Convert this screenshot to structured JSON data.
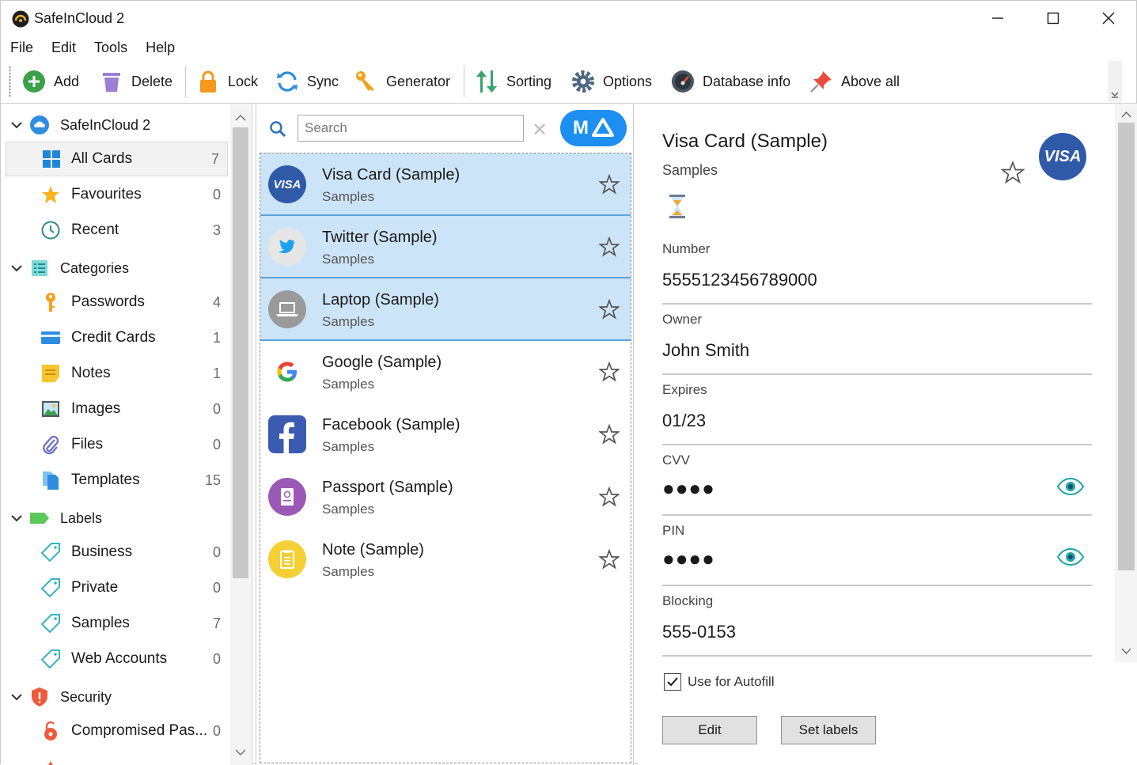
{
  "window": {
    "title": "SafeInCloud 2"
  },
  "menu": [
    "File",
    "Edit",
    "Tools",
    "Help"
  ],
  "toolbar": {
    "add": "Add",
    "delete": "Delete",
    "lock": "Lock",
    "sync": "Sync",
    "generator": "Generator",
    "sorting": "Sorting",
    "options": "Options",
    "database_info": "Database info",
    "above_all": "Above all"
  },
  "sidebar": {
    "root": "SafeInCloud 2",
    "all_cards": {
      "label": "All Cards",
      "count": "7"
    },
    "favourites": {
      "label": "Favourites",
      "count": "0"
    },
    "recent": {
      "label": "Recent",
      "count": "3"
    },
    "categories": {
      "label": "Categories",
      "items": [
        {
          "label": "Passwords",
          "count": "4"
        },
        {
          "label": "Credit Cards",
          "count": "1"
        },
        {
          "label": "Notes",
          "count": "1"
        },
        {
          "label": "Images",
          "count": "0"
        },
        {
          "label": "Files",
          "count": "0"
        },
        {
          "label": "Templates",
          "count": "15"
        }
      ]
    },
    "labels": {
      "label": "Labels",
      "items": [
        {
          "label": "Business",
          "count": "0"
        },
        {
          "label": "Private",
          "count": "0"
        },
        {
          "label": "Samples",
          "count": "7"
        },
        {
          "label": "Web Accounts",
          "count": "0"
        }
      ]
    },
    "security": {
      "label": "Security",
      "items": [
        {
          "label": "Compromised Pas...",
          "count": "0"
        }
      ]
    }
  },
  "search": {
    "placeholder": "Search",
    "badge": "M"
  },
  "cards": [
    {
      "title": "Visa Card (Sample)",
      "subtitle": "Samples",
      "selected": true,
      "icon": "visa-icon"
    },
    {
      "title": "Twitter (Sample)",
      "subtitle": "Samples",
      "selected": true,
      "icon": "twitter-icon"
    },
    {
      "title": "Laptop (Sample)",
      "subtitle": "Samples",
      "selected": true,
      "icon": "laptop-icon"
    },
    {
      "title": "Google (Sample)",
      "subtitle": "Samples",
      "selected": false,
      "icon": "google-icon"
    },
    {
      "title": "Facebook (Sample)",
      "subtitle": "Samples",
      "selected": false,
      "icon": "facebook-icon"
    },
    {
      "title": "Passport (Sample)",
      "subtitle": "Samples",
      "selected": false,
      "icon": "passport-icon"
    },
    {
      "title": "Note (Sample)",
      "subtitle": "Samples",
      "selected": false,
      "icon": "note-icon"
    }
  ],
  "detail": {
    "title": "Visa Card (Sample)",
    "subtitle": "Samples",
    "logo": "VISA",
    "fields": [
      {
        "label": "Number",
        "value": "5555123456789000"
      },
      {
        "label": "Owner",
        "value": "John Smith"
      },
      {
        "label": "Expires",
        "value": "01/23"
      },
      {
        "label": "CVV",
        "value": "●●●●"
      },
      {
        "label": "PIN",
        "value": "●●●●"
      },
      {
        "label": "Blocking",
        "value": "555-0153"
      }
    ],
    "autofill_label": "Use for Autofill",
    "autofill_checked": true,
    "edit_button": "Edit",
    "set_labels_button": "Set labels"
  },
  "colors": {
    "accent": "#1c8ff0",
    "selection": "#cce4f7",
    "visa": "#2e5aa8"
  }
}
